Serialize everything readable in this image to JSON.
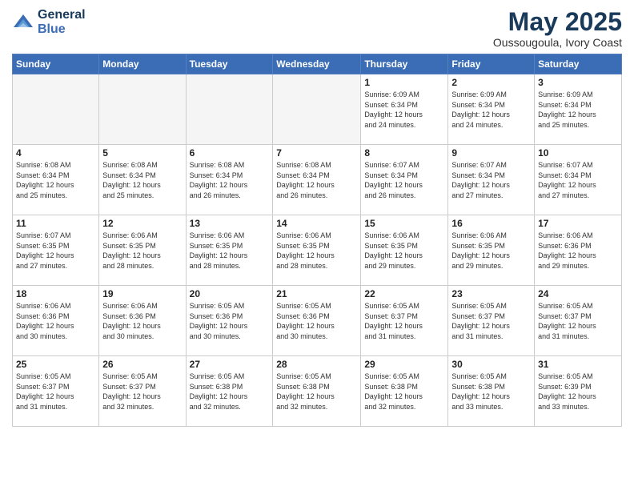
{
  "header": {
    "logo_line1": "General",
    "logo_line2": "Blue",
    "title": "May 2025",
    "subtitle": "Oussougoula, Ivory Coast"
  },
  "weekdays": [
    "Sunday",
    "Monday",
    "Tuesday",
    "Wednesday",
    "Thursday",
    "Friday",
    "Saturday"
  ],
  "weeks": [
    [
      {
        "day": "",
        "info": ""
      },
      {
        "day": "",
        "info": ""
      },
      {
        "day": "",
        "info": ""
      },
      {
        "day": "",
        "info": ""
      },
      {
        "day": "1",
        "info": "Sunrise: 6:09 AM\nSunset: 6:34 PM\nDaylight: 12 hours\nand 24 minutes."
      },
      {
        "day": "2",
        "info": "Sunrise: 6:09 AM\nSunset: 6:34 PM\nDaylight: 12 hours\nand 24 minutes."
      },
      {
        "day": "3",
        "info": "Sunrise: 6:09 AM\nSunset: 6:34 PM\nDaylight: 12 hours\nand 25 minutes."
      }
    ],
    [
      {
        "day": "4",
        "info": "Sunrise: 6:08 AM\nSunset: 6:34 PM\nDaylight: 12 hours\nand 25 minutes."
      },
      {
        "day": "5",
        "info": "Sunrise: 6:08 AM\nSunset: 6:34 PM\nDaylight: 12 hours\nand 25 minutes."
      },
      {
        "day": "6",
        "info": "Sunrise: 6:08 AM\nSunset: 6:34 PM\nDaylight: 12 hours\nand 26 minutes."
      },
      {
        "day": "7",
        "info": "Sunrise: 6:08 AM\nSunset: 6:34 PM\nDaylight: 12 hours\nand 26 minutes."
      },
      {
        "day": "8",
        "info": "Sunrise: 6:07 AM\nSunset: 6:34 PM\nDaylight: 12 hours\nand 26 minutes."
      },
      {
        "day": "9",
        "info": "Sunrise: 6:07 AM\nSunset: 6:34 PM\nDaylight: 12 hours\nand 27 minutes."
      },
      {
        "day": "10",
        "info": "Sunrise: 6:07 AM\nSunset: 6:34 PM\nDaylight: 12 hours\nand 27 minutes."
      }
    ],
    [
      {
        "day": "11",
        "info": "Sunrise: 6:07 AM\nSunset: 6:35 PM\nDaylight: 12 hours\nand 27 minutes."
      },
      {
        "day": "12",
        "info": "Sunrise: 6:06 AM\nSunset: 6:35 PM\nDaylight: 12 hours\nand 28 minutes."
      },
      {
        "day": "13",
        "info": "Sunrise: 6:06 AM\nSunset: 6:35 PM\nDaylight: 12 hours\nand 28 minutes."
      },
      {
        "day": "14",
        "info": "Sunrise: 6:06 AM\nSunset: 6:35 PM\nDaylight: 12 hours\nand 28 minutes."
      },
      {
        "day": "15",
        "info": "Sunrise: 6:06 AM\nSunset: 6:35 PM\nDaylight: 12 hours\nand 29 minutes."
      },
      {
        "day": "16",
        "info": "Sunrise: 6:06 AM\nSunset: 6:35 PM\nDaylight: 12 hours\nand 29 minutes."
      },
      {
        "day": "17",
        "info": "Sunrise: 6:06 AM\nSunset: 6:36 PM\nDaylight: 12 hours\nand 29 minutes."
      }
    ],
    [
      {
        "day": "18",
        "info": "Sunrise: 6:06 AM\nSunset: 6:36 PM\nDaylight: 12 hours\nand 30 minutes."
      },
      {
        "day": "19",
        "info": "Sunrise: 6:06 AM\nSunset: 6:36 PM\nDaylight: 12 hours\nand 30 minutes."
      },
      {
        "day": "20",
        "info": "Sunrise: 6:05 AM\nSunset: 6:36 PM\nDaylight: 12 hours\nand 30 minutes."
      },
      {
        "day": "21",
        "info": "Sunrise: 6:05 AM\nSunset: 6:36 PM\nDaylight: 12 hours\nand 30 minutes."
      },
      {
        "day": "22",
        "info": "Sunrise: 6:05 AM\nSunset: 6:37 PM\nDaylight: 12 hours\nand 31 minutes."
      },
      {
        "day": "23",
        "info": "Sunrise: 6:05 AM\nSunset: 6:37 PM\nDaylight: 12 hours\nand 31 minutes."
      },
      {
        "day": "24",
        "info": "Sunrise: 6:05 AM\nSunset: 6:37 PM\nDaylight: 12 hours\nand 31 minutes."
      }
    ],
    [
      {
        "day": "25",
        "info": "Sunrise: 6:05 AM\nSunset: 6:37 PM\nDaylight: 12 hours\nand 31 minutes."
      },
      {
        "day": "26",
        "info": "Sunrise: 6:05 AM\nSunset: 6:37 PM\nDaylight: 12 hours\nand 32 minutes."
      },
      {
        "day": "27",
        "info": "Sunrise: 6:05 AM\nSunset: 6:38 PM\nDaylight: 12 hours\nand 32 minutes."
      },
      {
        "day": "28",
        "info": "Sunrise: 6:05 AM\nSunset: 6:38 PM\nDaylight: 12 hours\nand 32 minutes."
      },
      {
        "day": "29",
        "info": "Sunrise: 6:05 AM\nSunset: 6:38 PM\nDaylight: 12 hours\nand 32 minutes."
      },
      {
        "day": "30",
        "info": "Sunrise: 6:05 AM\nSunset: 6:38 PM\nDaylight: 12 hours\nand 33 minutes."
      },
      {
        "day": "31",
        "info": "Sunrise: 6:05 AM\nSunset: 6:39 PM\nDaylight: 12 hours\nand 33 minutes."
      }
    ]
  ]
}
